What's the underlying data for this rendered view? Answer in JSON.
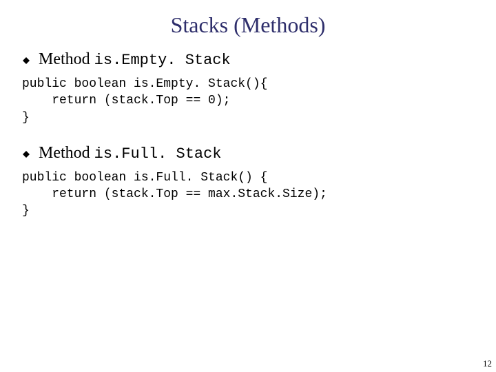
{
  "title": "Stacks (Methods)",
  "bullets": [
    {
      "label": "Method ",
      "mono": "is.Empty. Stack"
    },
    {
      "label": "Method ",
      "mono": "is.Full. Stack"
    }
  ],
  "code": [
    "public boolean is.Empty. Stack(){\n    return (stack.Top == 0);\n}",
    "public boolean is.Full. Stack() {\n    return (stack.Top == max.Stack.Size);\n}"
  ],
  "page_number": "12"
}
